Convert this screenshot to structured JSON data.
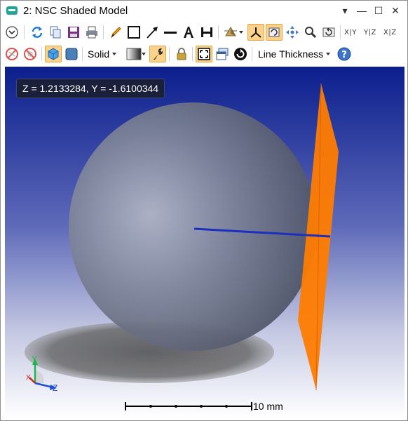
{
  "window": {
    "title": "2: NSC Shaded Model",
    "controls": [
      "▾",
      "—",
      "☐",
      "✕"
    ]
  },
  "toolbar2": {
    "render_mode": "Solid",
    "line_thickness": "Line Thickness",
    "axis_labels": [
      "X|Y",
      "Y|Z",
      "X|Z"
    ]
  },
  "viewport": {
    "cursor_readout": "Z = 1.2133284, Y = -1.6100344",
    "scale_bar_label": "10 mm",
    "axes": {
      "y": "Y",
      "z": "Z",
      "x": "X"
    }
  },
  "colors": {
    "background_top": "#0b1e8d",
    "background_bottom": "#ffffff",
    "sphere": "#6b7184",
    "detector_plane": "#ff7f00",
    "ray": "#1c2fbf",
    "active_button": "#fbd28a"
  },
  "icons": [
    "collapse-icon",
    "refresh-icon",
    "copy-icon",
    "save-icon",
    "print-icon",
    "pencil-icon",
    "rectangle-icon",
    "arrow-icon",
    "line-icon",
    "text-icon",
    "dimension-icon",
    "light-icon",
    "axes-icon",
    "rotate-icon",
    "pan-icon",
    "zoom-icon",
    "reset-icon",
    "no-rays-icon",
    "no-objects-icon",
    "shaded-cube-icon",
    "flat-cube-icon",
    "gradient-icon",
    "wrench-icon",
    "lock-icon",
    "fit-icon",
    "window-icon",
    "cycle-icon",
    "help-icon"
  ]
}
